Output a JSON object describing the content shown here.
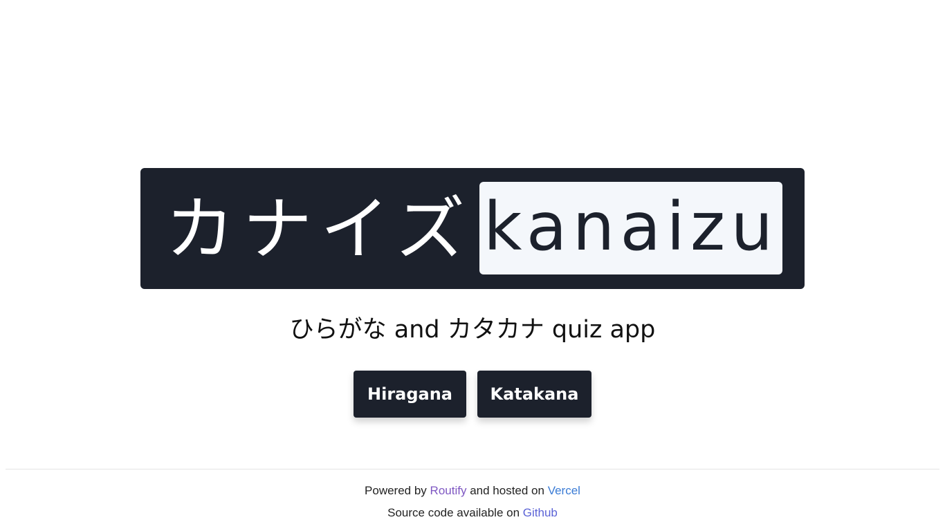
{
  "logo": {
    "kana": "カナイズ",
    "romaji": "kanaizu"
  },
  "tagline": "ひらがな and カタカナ quiz app",
  "buttons": {
    "hiragana": "Hiragana",
    "katakana": "Katakana"
  },
  "footer": {
    "powered_by_prefix": "Powered by",
    "routify_link": "Routify",
    "hosted_on": "and hosted on",
    "vercel_link": "Vercel",
    "source_prefix": "Source code available on",
    "github_link": "Github"
  },
  "colors": {
    "primary_dark": "#1c212c",
    "logo_box_light": "#f4f7fb",
    "routify_purple": "#7e57c2",
    "vercel_blue": "#3a7bd5",
    "github_indigo": "#5b63d6"
  }
}
